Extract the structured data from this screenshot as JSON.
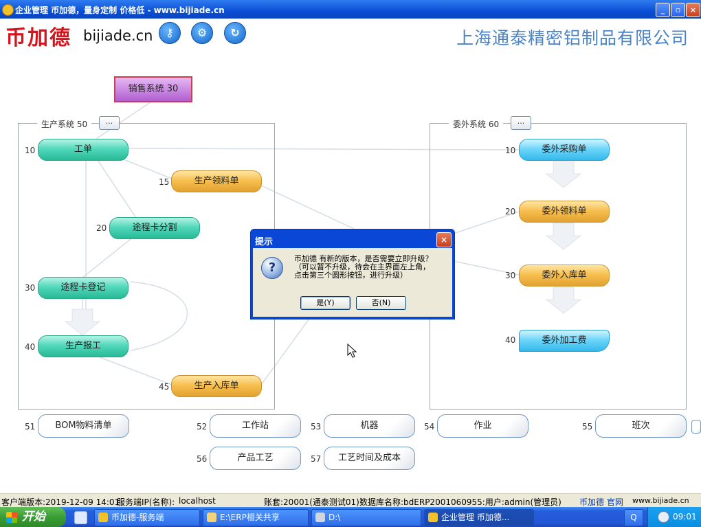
{
  "window": {
    "title": "企业管理  币加德，量身定制 价格低 - www.bijiade.cn",
    "buttons": [
      "minimize",
      "maximize",
      "close"
    ]
  },
  "header": {
    "logo_text": "币加德",
    "domain": "bijiade.cn",
    "icons": [
      "key-icon",
      "gear-icon",
      "refresh-icon"
    ],
    "company": "上海通泰精密铝制品有限公司"
  },
  "sales": {
    "label": "销售系统 30"
  },
  "production": {
    "label": "生产系统 50",
    "more": "...",
    "nodes": [
      {
        "num": "10",
        "label": "工单"
      },
      {
        "num": "15",
        "label": "生产领料单"
      },
      {
        "num": "20",
        "label": "途程卡分割"
      },
      {
        "num": "30",
        "label": "途程卡登记"
      },
      {
        "num": "40",
        "label": "生产报工"
      },
      {
        "num": "45",
        "label": "生产入库单"
      }
    ]
  },
  "outsource": {
    "label": "委外系统 60",
    "more": "...",
    "nodes": [
      {
        "num": "10",
        "label": "委外采购单"
      },
      {
        "num": "20",
        "label": "委外领料单"
      },
      {
        "num": "30",
        "label": "委外入库单"
      },
      {
        "num": "40",
        "label": "委外加工费"
      }
    ]
  },
  "tiles": [
    {
      "num": "51",
      "label": "BOM物料清单"
    },
    {
      "num": "52",
      "label": "工作站"
    },
    {
      "num": "53",
      "label": "机器"
    },
    {
      "num": "54",
      "label": "作业"
    },
    {
      "num": "55",
      "label": "班次"
    },
    {
      "num": "56",
      "label": "产品工艺"
    },
    {
      "num": "57",
      "label": "工艺时间及成本"
    }
  ],
  "dialog": {
    "title": "提示",
    "lines": [
      "币加德 有新的版本，是否需要立即升级？",
      "（可以暂不升级，待会在主界面左上角，",
      "点击第三个圆形按钮，进行升级）"
    ],
    "yes": "是(Y)",
    "no": "否(N)"
  },
  "status": {
    "version": "客户端版本:2019-12-09 14:01",
    "server_label": "服务端IP(名称):",
    "server": "localhost",
    "account": "账套:20001(通泰测试01)",
    "db": "数据库名称:bdERP2001060955:用户:admin(管理员)",
    "site_name": "币加德 官网",
    "site_url": "www.bijiade.cn"
  },
  "taskbar": {
    "start": "开始",
    "items": [
      "币加德-服务端",
      "E:\\ERP相关共享",
      "D:\\",
      "企业管理 币加德..."
    ],
    "clock": "09:01"
  },
  "colors": {
    "accent": "#0b47d6",
    "teal": "#27b996",
    "orange": "#e1a12f",
    "blue": "#33b9ec",
    "brand_red": "#d9131b"
  }
}
